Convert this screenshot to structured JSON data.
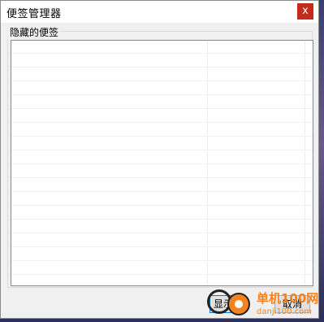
{
  "window": {
    "title": "便签管理器",
    "close_glyph": "x"
  },
  "group": {
    "label": "隐藏的便签"
  },
  "list": {
    "row_count": 18,
    "items": []
  },
  "buttons": {
    "ok_label": "显示",
    "cancel_label": "取消"
  },
  "watermark": {
    "brand": "单机100网",
    "url": "danji100.com",
    "color": "#f58220"
  },
  "colors": {
    "close_button": "#c42b1c",
    "dialog_bg": "#f0f0f0",
    "focus_border": "#0078d7"
  }
}
